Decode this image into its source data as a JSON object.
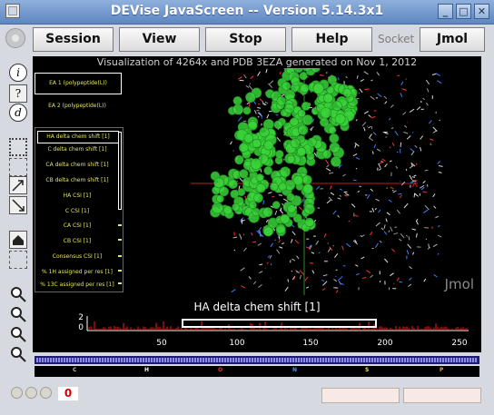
{
  "window": {
    "title": "DEVise JavaScreen -- Version 5.14.3x1",
    "controls": [
      "_",
      "□",
      "✕"
    ]
  },
  "toolbar": {
    "session": "Session",
    "view": "View",
    "stop": "Stop",
    "help": "Help",
    "socket": "Socket",
    "jmol": "Jmol"
  },
  "left_tools": {
    "info": "i",
    "help": "?",
    "detail": "d"
  },
  "header": {
    "text": "Visualization of 4264x and PDB 3EZA generated on Nov 1, 2012"
  },
  "entity_views": [
    "EA 1 (polypeptide(L))",
    "EA 2 (polypeptide(L))"
  ],
  "data_views": [
    "HA delta chem shift [1]",
    "C delta chem shift [1]",
    "CA delta chem shift [1]",
    "CB delta chem shift [1]",
    "HA CSI [1]",
    "C CSI [1]",
    "CA CSI [1]",
    "CB CSI [1]",
    "Consensus CSI [1]",
    "% 1H assigned per res [1]",
    "% 13C assigned per res [1]"
  ],
  "viewer": {
    "watermark": "Jmol"
  },
  "plot": {
    "title": "HA delta chem shift [1]",
    "y_ticks": [
      "2",
      "0"
    ],
    "x_ticks": [
      "50",
      "100",
      "150",
      "200",
      "250"
    ]
  },
  "atom_legend": [
    {
      "label": "C",
      "color": "#bbbbbb"
    },
    {
      "label": "H",
      "color": "#ffffff"
    },
    {
      "label": "O",
      "color": "#ff2a2a"
    },
    {
      "label": "N",
      "color": "#3aa0ff"
    },
    {
      "label": "S",
      "color": "#ffe25a"
    },
    {
      "label": "P",
      "color": "#ff9a2a"
    }
  ],
  "status": {
    "error_count": "0"
  },
  "colors": {
    "selection_green": "#39d339",
    "series_red": "#ff1a1a"
  }
}
